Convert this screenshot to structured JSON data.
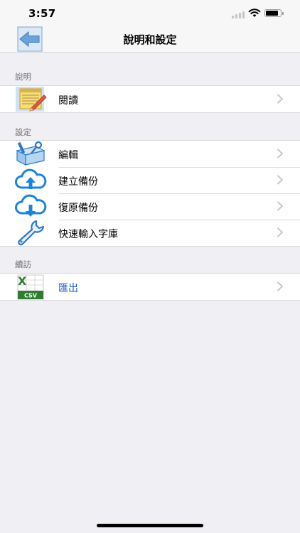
{
  "status_bar": {
    "time": "3:57",
    "icons": [
      "cellular-signal-icon",
      "wifi-icon",
      "battery-icon"
    ]
  },
  "nav": {
    "title": "說明和設定",
    "back_icon": "back-arrow-icon"
  },
  "sections": [
    {
      "header": "說明",
      "items": [
        {
          "label": "閱讀",
          "icon": "notepad-pencil-icon"
        }
      ]
    },
    {
      "header": "設定",
      "items": [
        {
          "label": "編輯",
          "icon": "tools-icon"
        },
        {
          "label": "建立備份",
          "icon": "cloud-upload-icon"
        },
        {
          "label": "復原備份",
          "icon": "cloud-download-icon"
        },
        {
          "label": "快速輸入字庫",
          "icon": "wrench-icon"
        }
      ]
    },
    {
      "header": "續訪",
      "items": [
        {
          "label": "匯出",
          "icon": "excel-csv-icon",
          "icon_text": "CSV"
        }
      ]
    }
  ],
  "colors": {
    "background": "#efeff4",
    "accent_blue": "#1a5cbf",
    "cloud_blue": "#1f84d6",
    "excel_green": "#2e7d32",
    "chevron": "#c7c7cc"
  }
}
